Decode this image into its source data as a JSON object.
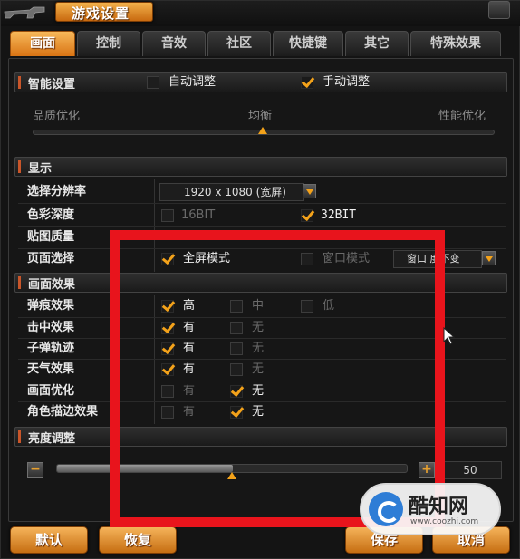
{
  "window": {
    "title": "游戏设置"
  },
  "tabs": [
    {
      "label": "画面",
      "active": true
    },
    {
      "label": "控制",
      "active": false
    },
    {
      "label": "音效",
      "active": false
    },
    {
      "label": "社区",
      "active": false
    },
    {
      "label": "快捷键",
      "active": false
    },
    {
      "label": "其它",
      "active": false
    },
    {
      "label": "特殊效果",
      "active": false
    }
  ],
  "smart": {
    "title": "智能设置",
    "auto": {
      "label": "自动调整",
      "checked": false
    },
    "manual": {
      "label": "手动调整",
      "checked": true
    },
    "slider_labels": [
      "品质优化",
      "均衡",
      "性能优化"
    ]
  },
  "display": {
    "title": "显示",
    "resolution_label": "选择分辨率",
    "resolution_value": "1920 x 1080 (宽屏)",
    "color_depth_label": "色彩深度",
    "color_16": {
      "label": "16BIT",
      "checked": false
    },
    "color_32": {
      "label": "32BIT",
      "checked": true
    },
    "texture_label": "贴图质量",
    "page_label": "页面选择",
    "fullscreen": {
      "label": "全屏模式",
      "checked": true
    },
    "windowed": {
      "label": "窗口模式",
      "checked": false
    },
    "window_size_value": "窗口 度不变"
  },
  "effects": {
    "title": "画面效果",
    "rows": [
      {
        "label": "弹痕效果",
        "options": [
          {
            "label": "高",
            "checked": true
          },
          {
            "label": "中",
            "checked": false
          },
          {
            "label": "低",
            "checked": false
          }
        ]
      },
      {
        "label": "击中效果",
        "options": [
          {
            "label": "有",
            "checked": true
          },
          {
            "label": "无",
            "checked": false
          }
        ]
      },
      {
        "label": "子弹轨迹",
        "options": [
          {
            "label": "有",
            "checked": true
          },
          {
            "label": "无",
            "checked": false
          }
        ]
      },
      {
        "label": "天气效果",
        "options": [
          {
            "label": "有",
            "checked": true
          },
          {
            "label": "无",
            "checked": false
          }
        ]
      },
      {
        "label": "画面优化",
        "options": [
          {
            "label": "有",
            "checked": false
          },
          {
            "label": "无",
            "checked": true
          }
        ]
      },
      {
        "label": "角色描边效果",
        "options": [
          {
            "label": "有",
            "checked": false
          },
          {
            "label": "无",
            "checked": true
          }
        ]
      }
    ]
  },
  "brightness": {
    "title": "亮度调整",
    "minus": "−",
    "plus": "+",
    "value": "50",
    "level": 0.5
  },
  "buttons": {
    "default": "默认",
    "restore": "恢复",
    "save": "保存",
    "cancel": "取消"
  },
  "watermark": {
    "name": "酷知网",
    "url": "www.coozhi.com"
  },
  "colors": {
    "accent": "#f3a21a",
    "tab_active": "#e08a24",
    "highlight_box": "#e8141c",
    "background": "#141414"
  }
}
